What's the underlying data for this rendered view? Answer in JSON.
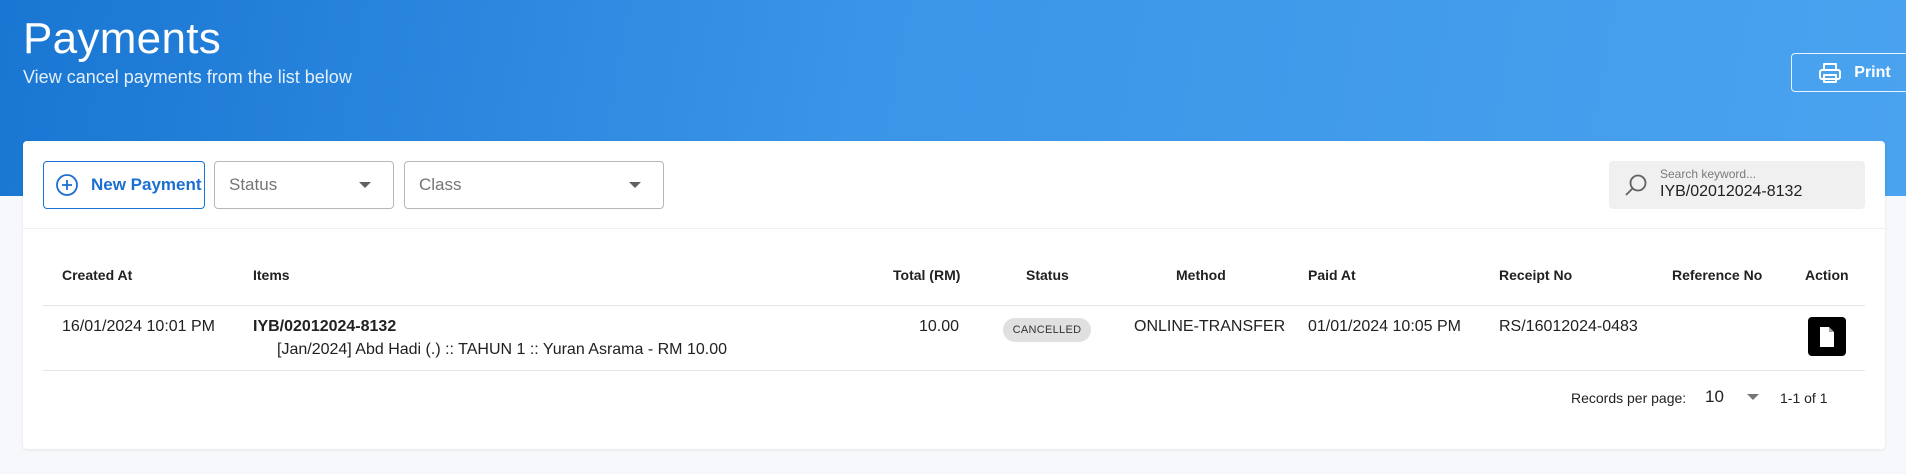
{
  "header": {
    "title": "Payments",
    "subtitle": "View cancel payments from the list below",
    "print_label": "Print"
  },
  "toolbar": {
    "new_payment_label": "New Payment",
    "status_placeholder": "Status",
    "class_placeholder": "Class",
    "search": {
      "placeholder": "Search keyword...",
      "value": "IYB/02012024-8132"
    }
  },
  "table": {
    "columns": [
      "Created At",
      "Items",
      "Total (RM)",
      "Status",
      "Method",
      "Paid At",
      "Receipt No",
      "Reference No",
      "Action"
    ],
    "rows": [
      {
        "created_at": "16/01/2024 10:01 PM",
        "item_code": "IYB/02012024-8132",
        "item_detail": "[Jan/2024] Abd Hadi (.) :: TAHUN 1 :: Yuran Asrama - RM 10.00",
        "total": "10.00",
        "status": "CANCELLED",
        "method": "ONLINE-TRANSFER",
        "paid_at": "01/01/2024 10:05 PM",
        "receipt_no": "RS/16012024-0483",
        "reference_no": ""
      }
    ]
  },
  "pagination": {
    "records_per_page_label": "Records per page:",
    "records_per_page": "10",
    "range": "1-1 of 1"
  },
  "colors": {
    "banner_start": "#1976d2",
    "banner_end": "#4aa3ef",
    "accent": "#1a6fd0",
    "chip_bg": "#e0e0e0",
    "action_bg": "#000000"
  },
  "icons": {
    "print": "printer-icon",
    "new_payment": "plus-circle-icon",
    "search": "search-icon",
    "dropdown": "chevron-down-icon",
    "action": "document-icon"
  }
}
